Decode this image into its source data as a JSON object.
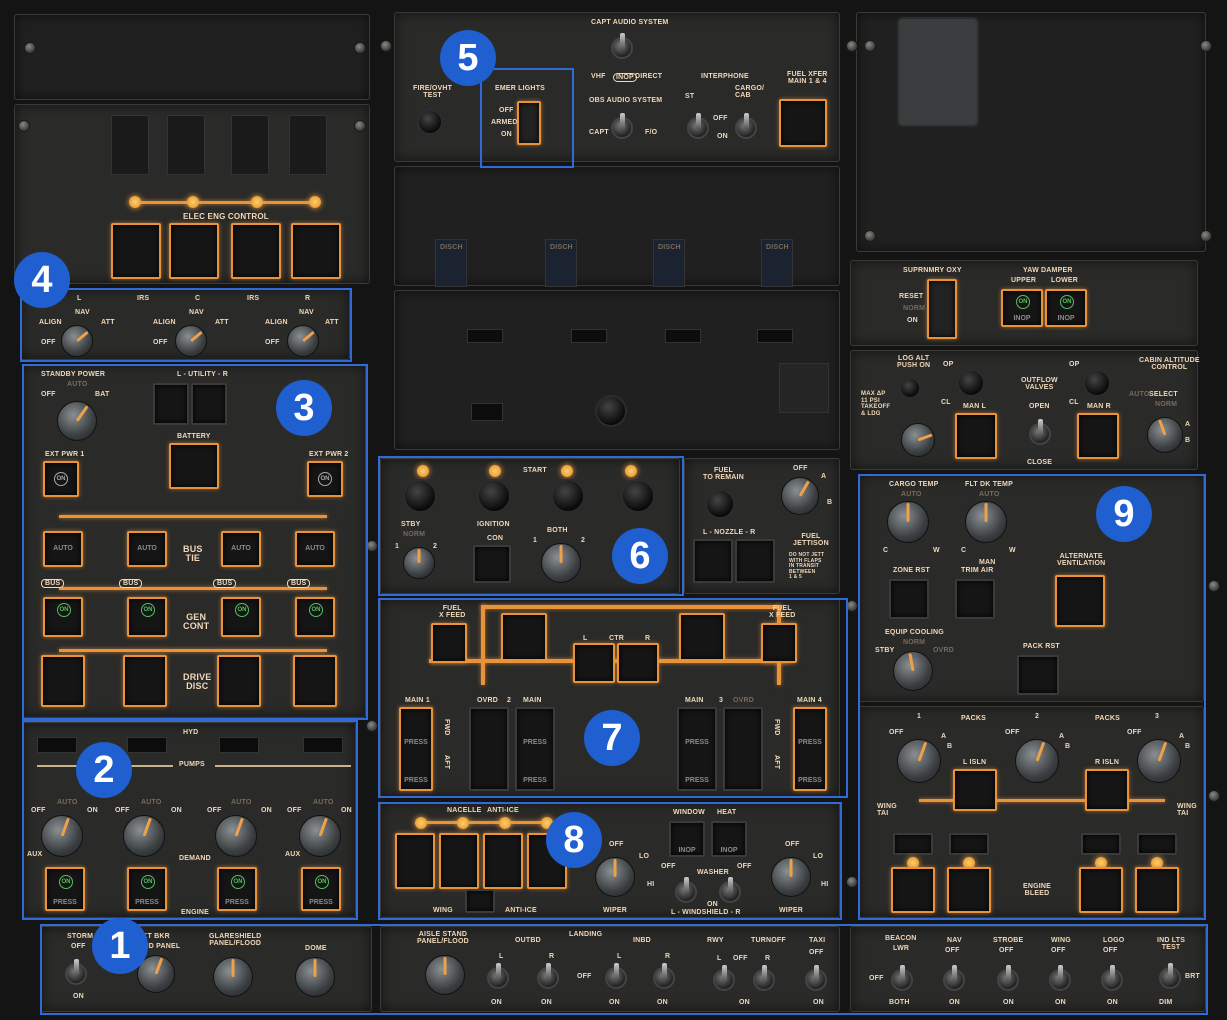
{
  "badges": [
    "1",
    "2",
    "3",
    "4",
    "5",
    "6",
    "7",
    "8",
    "9"
  ],
  "fire": {
    "fire_ovht_test": "FIRE/OVHT\nTEST"
  },
  "emer": {
    "title": "EMER LIGHTS",
    "off": "OFF",
    "armed": "ARMED",
    "on": "ON"
  },
  "audio": {
    "capt_audio": "CAPT AUDIO SYSTEM",
    "vhf": "VHF",
    "inop": "INOP",
    "direct": "DIRECT",
    "obs_audio": "OBS AUDIO SYSTEM",
    "capt": "CAPT",
    "fo": "F/O"
  },
  "interphone": {
    "title": "INTERPHONE",
    "st": "ST",
    "cargo": "CARGO/\nCAB",
    "off": "OFF",
    "on": "ON"
  },
  "fuel_xfer": {
    "title": "FUEL XFER\nMAIN 1 & 4"
  },
  "elec_eng": {
    "title": "ELEC ENG CONTROL"
  },
  "disch": [
    "DISCH",
    "DISCH",
    "DISCH",
    "DISCH"
  ],
  "disch_nums": [
    "1",
    "2",
    "3",
    "4"
  ],
  "irs": {
    "l": "L",
    "irs1": "IRS",
    "c": "C",
    "irs2": "IRS",
    "r": "R",
    "align": "ALIGN",
    "nav": "NAV",
    "att": "ATT",
    "off": "OFF"
  },
  "power": {
    "standby": "STANDBY POWER",
    "auto": "AUTO",
    "off": "OFF",
    "bat": "BAT",
    "l_utility_r": "L - UTILITY - R",
    "battery": "BATTERY",
    "ext_pwr1": "EXT PWR 1",
    "ext_pwr2": "EXT PWR 2",
    "on": "ON",
    "auto_lbl": "AUTO",
    "bus": "BUS",
    "bus_tie": "BUS\nTIE",
    "gen_cont": "GEN\nCONT",
    "drive_disc": "DRIVE\nDISC"
  },
  "hyd": {
    "hyd": "HYD",
    "pumps": "PUMPS",
    "auto": "AUTO",
    "off": "OFF",
    "on": "ON",
    "aux": "AUX",
    "demand": "DEMAND",
    "engine": "ENGINE",
    "press": "PRESS"
  },
  "lighting": {
    "storm": "STORM",
    "off": "OFF",
    "on": "ON",
    "ckt_bkr": "CKT  BKR",
    "ovhd_panel": "OVHD  PANEL",
    "glareshield": "GLARESHIELD\nPANEL/FLOOD",
    "dome": "DOME",
    "aisle": "AISLE STAND\nPANEL/FLOOD",
    "landing": "LANDING",
    "outbd": "OUTBD",
    "inbd": "INBD",
    "l": "L",
    "r": "R",
    "rwy": "RWY",
    "turnoff": "TURNOFF",
    "taxi": "TAXI",
    "beacon": "BEACON",
    "lwr": "LWR",
    "both": "BOTH",
    "nav": "NAV",
    "strobe": "STROBE",
    "wing": "WING",
    "logo": "LOGO",
    "ind_lts": "IND LTS\nTEST",
    "brt": "BRT",
    "dim": "DIM"
  },
  "start": {
    "start": "START",
    "stby": "STBY",
    "norm": "NORM",
    "ignition": "IGNITION",
    "con": "CON",
    "both": "BOTH",
    "one": "1",
    "two": "2",
    "fuel_to_remain": "FUEL\nTO REMAIN",
    "off": "OFF",
    "a": "A",
    "b": "B",
    "nozzle": "L  -  NOZZLE  -  R",
    "fuel_jettison": "FUEL\nJETTISON",
    "jettison_note": "DO NOT JETT\nWITH FLAPS\nIN TRANSIT\nBETWEEN\n1 & 5"
  },
  "fuel": {
    "fuel_x_feed_l": "FUEL\nX FEED",
    "fuel_x_feed_r": "FUEL\nX FEED",
    "l": "L",
    "ctr": "CTR",
    "r": "R",
    "main1": "MAIN 1",
    "main2": "MAIN",
    "main3": "MAIN",
    "main4": "MAIN 4",
    "ovrd2": "OVRD",
    "ovrd3": "OVRD",
    "two": "2",
    "three": "3",
    "fwd": "FWD",
    "aft": "AFT",
    "press": "PRESS"
  },
  "anti_ice": {
    "nacelle": "NACELLE",
    "anti_ice": "ANTI-ICE",
    "wing": "WING",
    "anti_ice2": "ANTI-ICE",
    "window": "WINDOW",
    "heat": "HEAT",
    "inop": "INOP",
    "off": "OFF",
    "lo": "LO",
    "hi": "HI",
    "washer": "WASHER",
    "windshield": "L - WINDSHIELD - R",
    "on": "ON",
    "wiper": "WIPER"
  },
  "oxy": {
    "suprnmry": "SUPRNMRY OXY",
    "reset": "RESET",
    "norm": "NORM",
    "on": "ON",
    "yaw": "YAW DAMPER",
    "upper": "UPPER",
    "lower": "LOWER",
    "inop": "INOP"
  },
  "press": {
    "log_alt": "LOG ALT\nPUSH ON",
    "max": "MAX ΔP\n11 PSI\nTAKEOFF\n& LDG",
    "op": "OP",
    "cl": "CL",
    "outflow": "OUTFLOW\nVALVES",
    "open": "OPEN",
    "close": "CLOSE",
    "man_l": "MAN L",
    "man_r": "MAN R",
    "cabin_alt": "CABIN ALTITUDE\nCONTROL",
    "auto": "AUTO",
    "select": "SELECT",
    "norm": "NORM",
    "a": "A",
    "b": "B"
  },
  "air": {
    "cargo_temp": "CARGO TEMP",
    "flt_dk": "FLT DK TEMP",
    "auto": "AUTO",
    "c": "C",
    "w": "W",
    "zone_rst": "ZONE RST",
    "man": "MAN",
    "trim_air": "TRIM AIR",
    "alt_vent": "ALTERNATE\nVENTILATION",
    "equip": "EQUIP COOLING",
    "norm": "NORM",
    "stby": "STBY",
    "ovrd": "OVRD",
    "pack_rst": "PACK RST",
    "packs1": "PACKS",
    "packs2": "PACKS",
    "one": "1",
    "two": "2",
    "three": "3",
    "off": "OFF",
    "a": "A",
    "b": "B",
    "l_isln": "L ISLN",
    "r_isln": "R ISLN",
    "wing_tai_l": "WING\nTAI",
    "wing_tai_r": "WING\nTAI",
    "engine_bleed": "ENGINE\nBLEED"
  }
}
